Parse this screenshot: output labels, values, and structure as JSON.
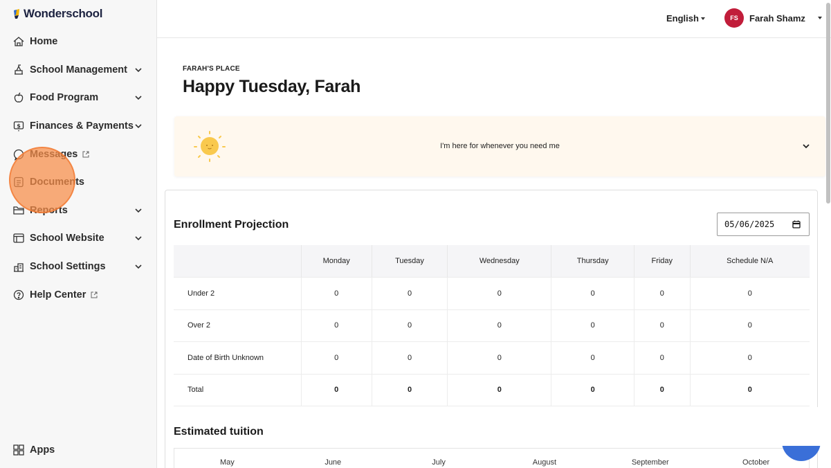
{
  "brand": {
    "name": "Wonderschool"
  },
  "sidebar": {
    "items": [
      {
        "label": "Home",
        "icon": "home-icon",
        "chevron": false,
        "external": false
      },
      {
        "label": "School Management",
        "icon": "school-management-icon",
        "chevron": true,
        "external": false
      },
      {
        "label": "Food Program",
        "icon": "apple-icon",
        "chevron": true,
        "external": false
      },
      {
        "label": "Finances & Payments",
        "icon": "dollar-icon",
        "chevron": true,
        "external": false
      },
      {
        "label": "Messages",
        "icon": "messages-icon",
        "chevron": false,
        "external": true
      },
      {
        "label": "Documents",
        "icon": "document-icon",
        "chevron": false,
        "external": false
      },
      {
        "label": "Reports",
        "icon": "folder-icon",
        "chevron": true,
        "external": false
      },
      {
        "label": "School Website",
        "icon": "website-icon",
        "chevron": true,
        "external": false
      },
      {
        "label": "School Settings",
        "icon": "settings-building-icon",
        "chevron": true,
        "external": false
      },
      {
        "label": "Help Center",
        "icon": "help-icon",
        "chevron": false,
        "external": true
      }
    ],
    "apps_label": "Apps"
  },
  "header": {
    "language": "English",
    "user_initials": "FS",
    "user_name": "Farah Shamz"
  },
  "main": {
    "school_name": "FARAH'S PLACE",
    "greeting": "Happy Tuesday, Farah",
    "banner_message": "I'm here for whenever you need me",
    "enrollment": {
      "title": "Enrollment Projection",
      "date": "05/06/2025",
      "columns": [
        "",
        "Monday",
        "Tuesday",
        "Wednesday",
        "Thursday",
        "Friday",
        "Schedule N/A"
      ],
      "rows": [
        {
          "label": "Under 2",
          "values": [
            "0",
            "0",
            "0",
            "0",
            "0",
            "0"
          ]
        },
        {
          "label": "Over 2",
          "values": [
            "0",
            "0",
            "0",
            "0",
            "0",
            "0"
          ]
        },
        {
          "label": "Date of Birth Unknown",
          "values": [
            "0",
            "0",
            "0",
            "0",
            "0",
            "0"
          ]
        },
        {
          "label": "Total",
          "values": [
            "0",
            "0",
            "0",
            "0",
            "0",
            "0"
          ]
        }
      ]
    },
    "tuition": {
      "title": "Estimated tuition",
      "months": [
        "May",
        "June",
        "July",
        "August",
        "September",
        "October"
      ]
    }
  },
  "colors": {
    "avatar": "#c11d3a",
    "click_marker": "#f68c46",
    "banner_bg": "#fff8ee",
    "sidebar_bg": "#f7f7f7"
  }
}
